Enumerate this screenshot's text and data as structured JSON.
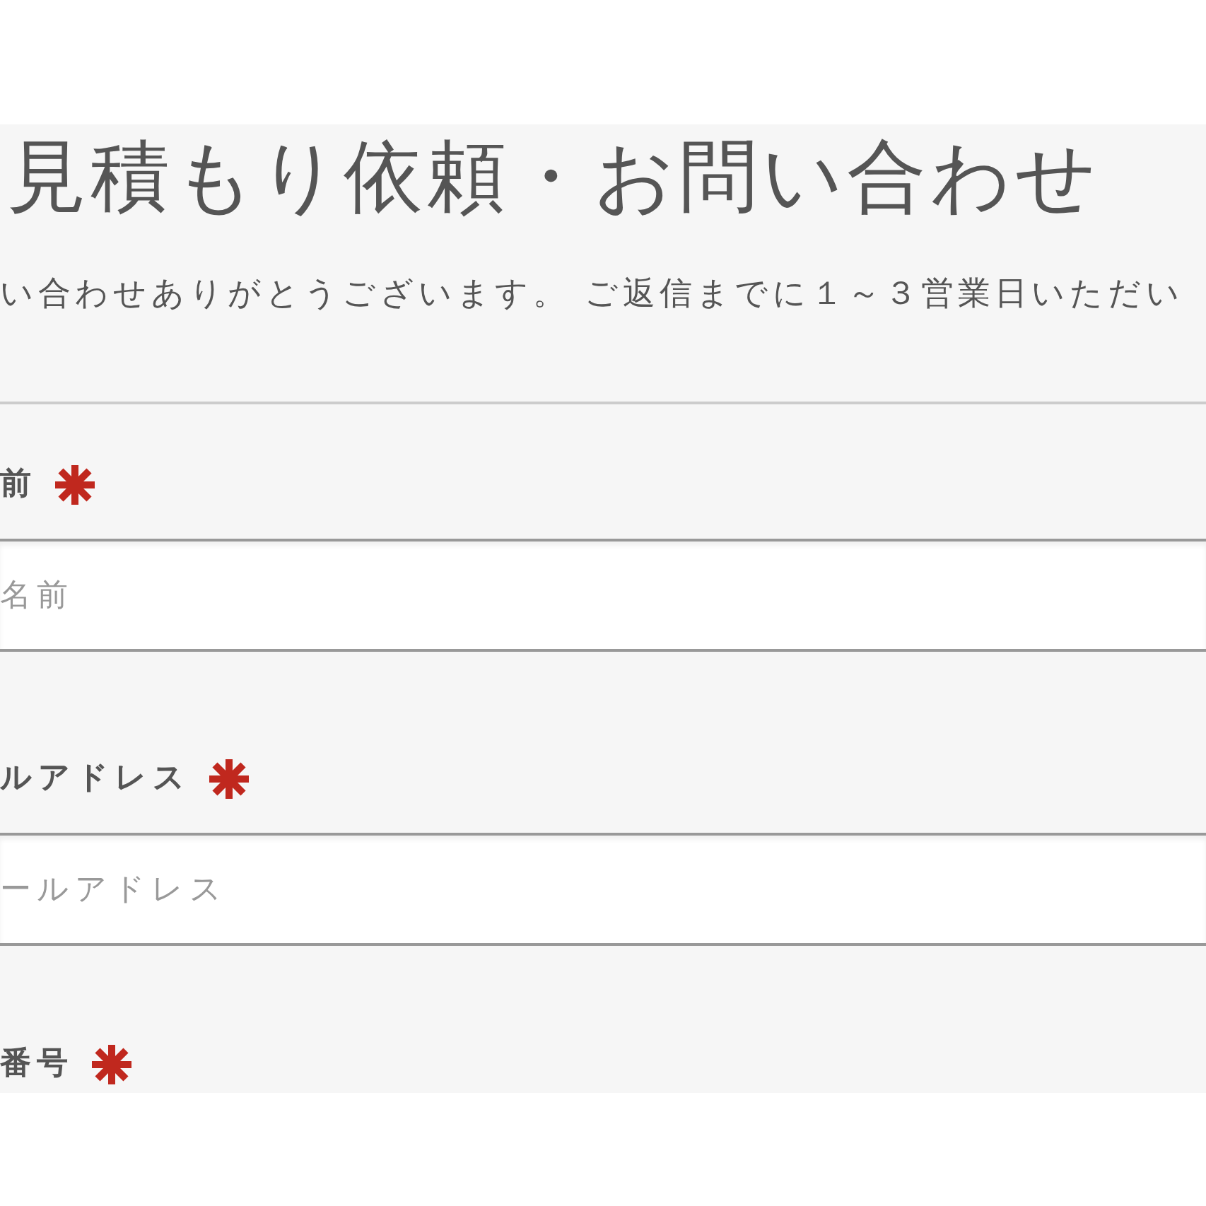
{
  "page": {
    "title": "見積もり依頼・お問い合わせ",
    "intro": "い合わせありがとうございます。 ご返信までに１～３営業日いただい"
  },
  "fields": [
    {
      "label": "前",
      "required": true,
      "placeholder": "名前"
    },
    {
      "label": "ルアドレス",
      "required": true,
      "placeholder": "ールアドレス"
    },
    {
      "label": "番号",
      "required": true
    }
  ]
}
